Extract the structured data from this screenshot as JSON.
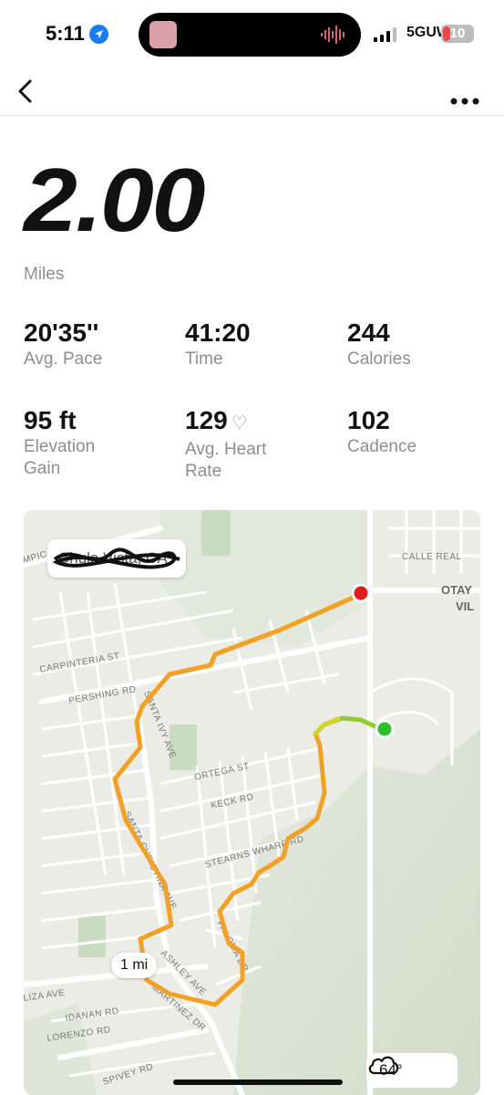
{
  "status_bar": {
    "time": "5:11",
    "network": "5GUW",
    "battery": "10"
  },
  "nav": {
    "back_icon": "chevron-left-icon",
    "more_icon": "more-dots-icon"
  },
  "summary": {
    "distance": "2.00",
    "distance_unit": "Miles"
  },
  "stats": [
    {
      "value": "20'35''",
      "label": "Avg. Pace"
    },
    {
      "value": "41:20",
      "label": "Time"
    },
    {
      "value": "244",
      "label": "Calories"
    },
    {
      "value": "95 ft",
      "label": "Elevation Gain"
    },
    {
      "value": "129",
      "label": "Avg. Heart Rate",
      "icon": "heart-icon"
    },
    {
      "value": "102",
      "label": "Cadence"
    }
  ],
  "map": {
    "location": "Chula Vista, CA",
    "mile_marker": "1 mi",
    "weather_temp": "64°",
    "weather_icon": "cloud-icon",
    "labels": {
      "calle_real": "CALLE REAL",
      "otay": "OTAY",
      "vil": "VIL",
      "olympic": "MPIC",
      "carpinteria": "CARPINTERIA ST",
      "pershing": "PERSHING RD",
      "santa_ivy": "SANTA IVY AVE",
      "ortega": "ORTEGA ST",
      "keck": "KECK RD",
      "stearns": "STEARNS WHARF RD",
      "santa_christina": "SANTA CHRISTINA AVE",
      "paseo": "PALOMA DR",
      "ashley": "ASHLEY AVE",
      "martinez": "MARTINEZ DR",
      "liza": "LIZA AVE",
      "idanan": "IDANAN RD",
      "lorenzo": "LORENZO RD",
      "spivey": "SPIVEY RD"
    }
  }
}
